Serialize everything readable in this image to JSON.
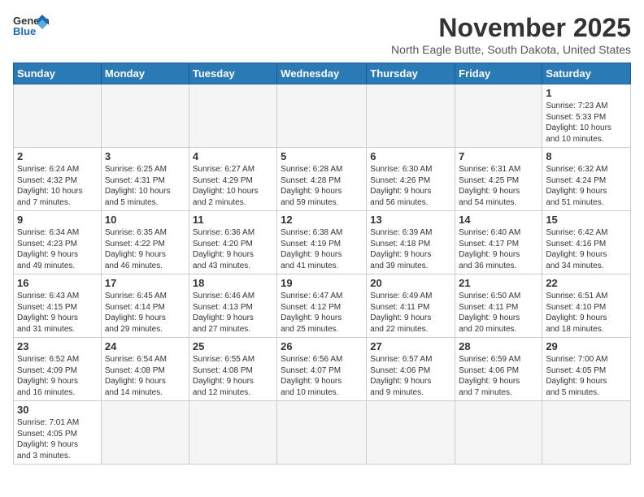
{
  "logo": {
    "general": "General",
    "blue": "Blue"
  },
  "title": "November 2025",
  "location": "North Eagle Butte, South Dakota, United States",
  "headers": [
    "Sunday",
    "Monday",
    "Tuesday",
    "Wednesday",
    "Thursday",
    "Friday",
    "Saturday"
  ],
  "weeks": [
    [
      {
        "day": "",
        "info": "",
        "empty": true
      },
      {
        "day": "",
        "info": "",
        "empty": true
      },
      {
        "day": "",
        "info": "",
        "empty": true
      },
      {
        "day": "",
        "info": "",
        "empty": true
      },
      {
        "day": "",
        "info": "",
        "empty": true
      },
      {
        "day": "",
        "info": "",
        "empty": true
      },
      {
        "day": "1",
        "info": "Sunrise: 7:23 AM\nSunset: 5:33 PM\nDaylight: 10 hours\nand 10 minutes.",
        "empty": false
      }
    ],
    [
      {
        "day": "2",
        "info": "Sunrise: 6:24 AM\nSunset: 4:32 PM\nDaylight: 10 hours\nand 7 minutes.",
        "empty": false
      },
      {
        "day": "3",
        "info": "Sunrise: 6:25 AM\nSunset: 4:31 PM\nDaylight: 10 hours\nand 5 minutes.",
        "empty": false
      },
      {
        "day": "4",
        "info": "Sunrise: 6:27 AM\nSunset: 4:29 PM\nDaylight: 10 hours\nand 2 minutes.",
        "empty": false
      },
      {
        "day": "5",
        "info": "Sunrise: 6:28 AM\nSunset: 4:28 PM\nDaylight: 9 hours\nand 59 minutes.",
        "empty": false
      },
      {
        "day": "6",
        "info": "Sunrise: 6:30 AM\nSunset: 4:26 PM\nDaylight: 9 hours\nand 56 minutes.",
        "empty": false
      },
      {
        "day": "7",
        "info": "Sunrise: 6:31 AM\nSunset: 4:25 PM\nDaylight: 9 hours\nand 54 minutes.",
        "empty": false
      },
      {
        "day": "8",
        "info": "Sunrise: 6:32 AM\nSunset: 4:24 PM\nDaylight: 9 hours\nand 51 minutes.",
        "empty": false
      }
    ],
    [
      {
        "day": "9",
        "info": "Sunrise: 6:34 AM\nSunset: 4:23 PM\nDaylight: 9 hours\nand 49 minutes.",
        "empty": false
      },
      {
        "day": "10",
        "info": "Sunrise: 6:35 AM\nSunset: 4:22 PM\nDaylight: 9 hours\nand 46 minutes.",
        "empty": false
      },
      {
        "day": "11",
        "info": "Sunrise: 6:36 AM\nSunset: 4:20 PM\nDaylight: 9 hours\nand 43 minutes.",
        "empty": false
      },
      {
        "day": "12",
        "info": "Sunrise: 6:38 AM\nSunset: 4:19 PM\nDaylight: 9 hours\nand 41 minutes.",
        "empty": false
      },
      {
        "day": "13",
        "info": "Sunrise: 6:39 AM\nSunset: 4:18 PM\nDaylight: 9 hours\nand 39 minutes.",
        "empty": false
      },
      {
        "day": "14",
        "info": "Sunrise: 6:40 AM\nSunset: 4:17 PM\nDaylight: 9 hours\nand 36 minutes.",
        "empty": false
      },
      {
        "day": "15",
        "info": "Sunrise: 6:42 AM\nSunset: 4:16 PM\nDaylight: 9 hours\nand 34 minutes.",
        "empty": false
      }
    ],
    [
      {
        "day": "16",
        "info": "Sunrise: 6:43 AM\nSunset: 4:15 PM\nDaylight: 9 hours\nand 31 minutes.",
        "empty": false
      },
      {
        "day": "17",
        "info": "Sunrise: 6:45 AM\nSunset: 4:14 PM\nDaylight: 9 hours\nand 29 minutes.",
        "empty": false
      },
      {
        "day": "18",
        "info": "Sunrise: 6:46 AM\nSunset: 4:13 PM\nDaylight: 9 hours\nand 27 minutes.",
        "empty": false
      },
      {
        "day": "19",
        "info": "Sunrise: 6:47 AM\nSunset: 4:12 PM\nDaylight: 9 hours\nand 25 minutes.",
        "empty": false
      },
      {
        "day": "20",
        "info": "Sunrise: 6:49 AM\nSunset: 4:11 PM\nDaylight: 9 hours\nand 22 minutes.",
        "empty": false
      },
      {
        "day": "21",
        "info": "Sunrise: 6:50 AM\nSunset: 4:11 PM\nDaylight: 9 hours\nand 20 minutes.",
        "empty": false
      },
      {
        "day": "22",
        "info": "Sunrise: 6:51 AM\nSunset: 4:10 PM\nDaylight: 9 hours\nand 18 minutes.",
        "empty": false
      }
    ],
    [
      {
        "day": "23",
        "info": "Sunrise: 6:52 AM\nSunset: 4:09 PM\nDaylight: 9 hours\nand 16 minutes.",
        "empty": false
      },
      {
        "day": "24",
        "info": "Sunrise: 6:54 AM\nSunset: 4:08 PM\nDaylight: 9 hours\nand 14 minutes.",
        "empty": false
      },
      {
        "day": "25",
        "info": "Sunrise: 6:55 AM\nSunset: 4:08 PM\nDaylight: 9 hours\nand 12 minutes.",
        "empty": false
      },
      {
        "day": "26",
        "info": "Sunrise: 6:56 AM\nSunset: 4:07 PM\nDaylight: 9 hours\nand 10 minutes.",
        "empty": false
      },
      {
        "day": "27",
        "info": "Sunrise: 6:57 AM\nSunset: 4:06 PM\nDaylight: 9 hours\nand 9 minutes.",
        "empty": false
      },
      {
        "day": "28",
        "info": "Sunrise: 6:59 AM\nSunset: 4:06 PM\nDaylight: 9 hours\nand 7 minutes.",
        "empty": false
      },
      {
        "day": "29",
        "info": "Sunrise: 7:00 AM\nSunset: 4:05 PM\nDaylight: 9 hours\nand 5 minutes.",
        "empty": false
      }
    ],
    [
      {
        "day": "30",
        "info": "Sunrise: 7:01 AM\nSunset: 4:05 PM\nDaylight: 9 hours\nand 3 minutes.",
        "empty": false
      },
      {
        "day": "",
        "info": "",
        "empty": true
      },
      {
        "day": "",
        "info": "",
        "empty": true
      },
      {
        "day": "",
        "info": "",
        "empty": true
      },
      {
        "day": "",
        "info": "",
        "empty": true
      },
      {
        "day": "",
        "info": "",
        "empty": true
      },
      {
        "day": "",
        "info": "",
        "empty": true
      }
    ]
  ]
}
